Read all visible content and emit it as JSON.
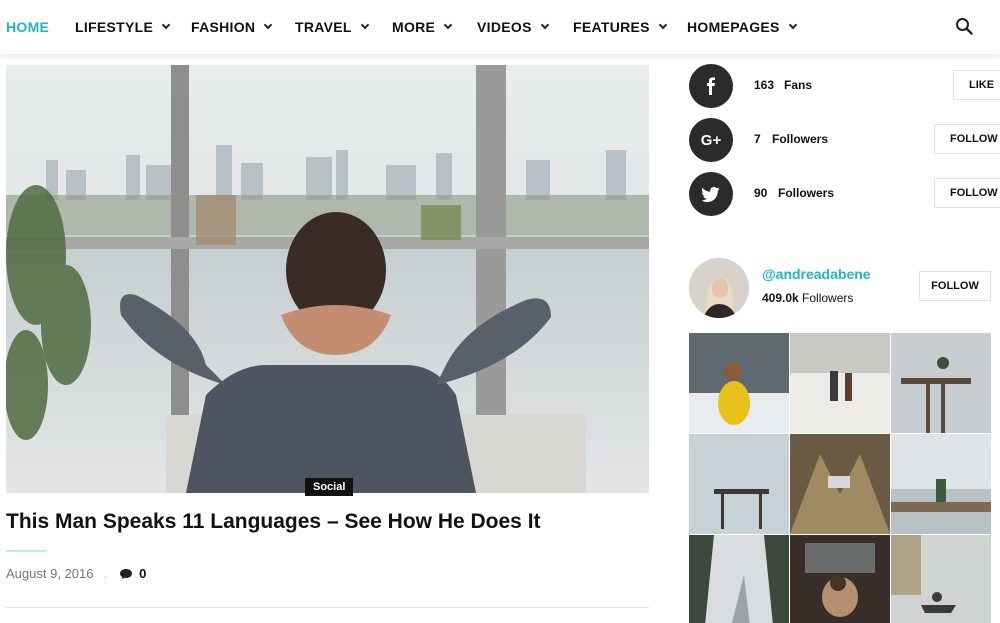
{
  "nav": {
    "items": [
      {
        "label": "HOME",
        "active": true,
        "has_dropdown": false
      },
      {
        "label": "LIFESTYLE",
        "active": false,
        "has_dropdown": true
      },
      {
        "label": "FASHION",
        "active": false,
        "has_dropdown": true
      },
      {
        "label": "TRAVEL",
        "active": false,
        "has_dropdown": true
      },
      {
        "label": "MORE",
        "active": false,
        "has_dropdown": true
      },
      {
        "label": "VIDEOS",
        "active": false,
        "has_dropdown": true
      },
      {
        "label": "FEATURES",
        "active": false,
        "has_dropdown": true
      },
      {
        "label": "HOMEPAGES",
        "active": false,
        "has_dropdown": true
      }
    ],
    "search_icon": "search-icon",
    "accent_color": "#1fb6c6"
  },
  "post": {
    "category": "Social",
    "title": "This Man Speaks 11 Languages – See How He Does It",
    "date": "August 9, 2016",
    "separator": ".",
    "comment_count": "0",
    "image": "man-relaxing-at-window-photo"
  },
  "sidebar": {
    "social": [
      {
        "network": "facebook",
        "icon": "facebook-icon",
        "count": "163",
        "label": "Fans",
        "button": "LIKE"
      },
      {
        "network": "google-plus",
        "icon": "google-plus-icon",
        "count": "7",
        "label": "Followers",
        "button": "FOLLOW"
      },
      {
        "network": "twitter",
        "icon": "twitter-icon",
        "count": "90",
        "label": "Followers",
        "button": "FOLLOW"
      }
    ],
    "instagram": {
      "handle": "@andreadabene",
      "followers_count": "409.0k",
      "followers_label": "Followers",
      "follow_button": "FOLLOW",
      "photos": [
        "yellow-jacket-girl",
        "winter-field-couple",
        "pier-ladder",
        "lake-platform",
        "car-splash",
        "shore-walker",
        "snowy-path",
        "car-interior",
        "misty-boat"
      ]
    }
  }
}
